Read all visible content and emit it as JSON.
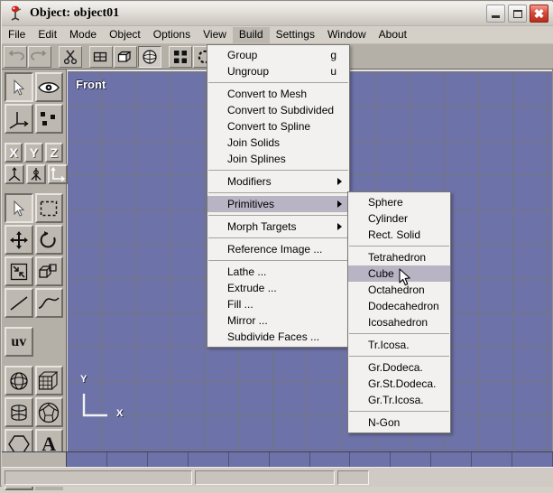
{
  "window": {
    "title": "Object: object01",
    "icon": "app-icon",
    "buttons": {
      "minimize": "minimize",
      "maximize": "maximize",
      "close": "close"
    }
  },
  "menubar": {
    "items": [
      {
        "label": "File",
        "active": false
      },
      {
        "label": "Edit",
        "active": false
      },
      {
        "label": "Mode",
        "active": false
      },
      {
        "label": "Object",
        "active": false
      },
      {
        "label": "Options",
        "active": false
      },
      {
        "label": "View",
        "active": false
      },
      {
        "label": "Build",
        "active": true
      },
      {
        "label": "Settings",
        "active": false
      },
      {
        "label": "Window",
        "active": false
      },
      {
        "label": "About",
        "active": false
      }
    ]
  },
  "toolbar": {
    "buttons": [
      {
        "name": "undo-icon",
        "selected": false
      },
      {
        "name": "redo-icon",
        "selected": false
      },
      {
        "name": "scissors-cut-icon",
        "selected": false
      },
      {
        "name": "wireframe-box-icon",
        "selected": false
      },
      {
        "name": "solid-box-icon",
        "selected": false
      },
      {
        "name": "shaded-sphere-icon",
        "selected": true
      },
      {
        "name": "four-points-icon",
        "selected": false
      },
      {
        "name": "circle-points-icon",
        "selected": false
      },
      {
        "name": "snap-icon",
        "selected": false
      }
    ]
  },
  "toolbox": {
    "groups": [
      {
        "name": "selection-group",
        "rows": [
          [
            {
              "name": "arrow-select-icon",
              "selected": true
            },
            {
              "name": "eye-visibility-icon",
              "selected": false
            }
          ],
          [
            {
              "name": "axis-origin-icon",
              "selected": false
            },
            {
              "name": "points-scatter-icon",
              "selected": false
            }
          ]
        ]
      },
      {
        "name": "axis-group",
        "rows": [
          [
            {
              "name": "axis-x-button",
              "label": "X",
              "selected": false
            },
            {
              "name": "axis-y-button",
              "label": "Y",
              "selected": false
            },
            {
              "name": "axis-z-button",
              "label": "Z",
              "selected": false
            }
          ],
          [
            {
              "name": "axis-tripod-icon",
              "selected": false
            },
            {
              "name": "axis-mirror-icon",
              "selected": false
            },
            {
              "name": "axis-corner-icon",
              "selected": false
            }
          ]
        ]
      },
      {
        "name": "transform-group",
        "rows": [
          [
            {
              "name": "arrow-pick-icon",
              "selected": true
            },
            {
              "name": "marquee-select-icon",
              "selected": false
            }
          ],
          [
            {
              "name": "move-icon",
              "selected": false
            },
            {
              "name": "rotate-icon",
              "selected": false
            }
          ],
          [
            {
              "name": "scale-icon",
              "selected": false
            },
            {
              "name": "shear-cube-icon",
              "selected": false
            }
          ],
          [
            {
              "name": "line-icon",
              "selected": false
            },
            {
              "name": "curve-icon",
              "selected": false
            }
          ]
        ]
      },
      {
        "name": "uv-group",
        "rows": [
          [
            {
              "name": "uv-button",
              "label": "uv",
              "selected": false
            }
          ]
        ]
      },
      {
        "name": "primitive-group",
        "rows": [
          [
            {
              "name": "sphere-primitive-icon",
              "selected": false
            },
            {
              "name": "cube-grid-primitive-icon",
              "selected": false
            }
          ],
          [
            {
              "name": "cylinder-primitive-icon",
              "selected": false
            },
            {
              "name": "polyhedron-primitive-icon",
              "selected": false
            }
          ],
          [
            {
              "name": "ngon-primitive-icon",
              "selected": false
            },
            {
              "name": "text-primitive-icon",
              "label": "A",
              "selected": false
            }
          ],
          [
            {
              "name": "grid-sheet-icon",
              "selected": false
            }
          ]
        ]
      }
    ]
  },
  "viewport": {
    "label": "Front",
    "background_color": "#6d72a8",
    "grid_color": "#787a5a",
    "axis_labels": {
      "y": "Y",
      "x": "X"
    }
  },
  "build_menu": {
    "items": [
      {
        "label": "Group",
        "accel": "g",
        "type": "item"
      },
      {
        "label": "Ungroup",
        "accel": "u",
        "type": "item"
      },
      {
        "type": "separator"
      },
      {
        "label": "Convert to Mesh",
        "type": "item"
      },
      {
        "label": "Convert to Subdivided",
        "type": "item"
      },
      {
        "label": "Convert to Spline",
        "type": "item"
      },
      {
        "label": "Join Solids",
        "type": "item"
      },
      {
        "label": "Join Splines",
        "type": "item"
      },
      {
        "type": "separator"
      },
      {
        "label": "Modifiers",
        "type": "submenu"
      },
      {
        "type": "separator"
      },
      {
        "label": "Primitives",
        "type": "submenu",
        "highlighted": true
      },
      {
        "type": "separator"
      },
      {
        "label": "Morph Targets",
        "type": "submenu"
      },
      {
        "type": "separator"
      },
      {
        "label": "Reference Image ...",
        "type": "item"
      },
      {
        "type": "separator"
      },
      {
        "label": "Lathe ...",
        "type": "item"
      },
      {
        "label": "Extrude ...",
        "type": "item"
      },
      {
        "label": "Fill ...",
        "type": "item"
      },
      {
        "label": "Mirror ...",
        "type": "item"
      },
      {
        "label": "Subdivide Faces ...",
        "type": "item"
      }
    ]
  },
  "primitives_menu": {
    "items": [
      {
        "label": "Sphere",
        "type": "item"
      },
      {
        "label": "Cylinder",
        "type": "item"
      },
      {
        "label": "Rect. Solid",
        "type": "item"
      },
      {
        "type": "separator"
      },
      {
        "label": "Tetrahedron",
        "type": "item"
      },
      {
        "label": "Cube",
        "type": "item",
        "highlighted": true
      },
      {
        "label": "Octahedron",
        "type": "item"
      },
      {
        "label": "Dodecahedron",
        "type": "item"
      },
      {
        "label": "Icosahedron",
        "type": "item"
      },
      {
        "type": "separator"
      },
      {
        "label": "Tr.Icosa.",
        "type": "item"
      },
      {
        "type": "separator"
      },
      {
        "label": "Gr.Dodeca.",
        "type": "item"
      },
      {
        "label": "Gr.St.Dodeca.",
        "type": "item"
      },
      {
        "label": "Gr.Tr.Icosa.",
        "type": "item"
      },
      {
        "type": "separator"
      },
      {
        "label": "N-Gon",
        "type": "item"
      }
    ]
  },
  "statusbar": {
    "fields": [
      "",
      "",
      ""
    ]
  },
  "colors": {
    "chrome": "#d4d0c8",
    "toolbar": "#b4b0a8",
    "viewport": "#6d72a8",
    "menu_highlight": "#b8b4c4",
    "menubar_active": "#bcb8b0"
  }
}
